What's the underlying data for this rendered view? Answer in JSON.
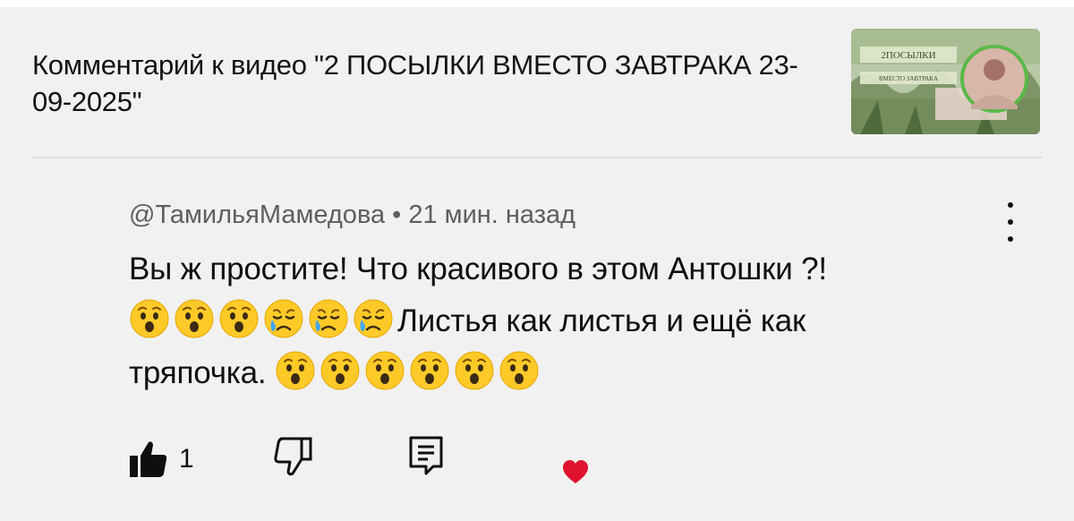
{
  "header": {
    "title": "Комментарий к видео \"2 ПОСЫЛКИ ВМЕСТО ЗАВТРАКА 23-09-2025\"",
    "thumbnail": {
      "caption_line1": "2ПОСЫЛКИ",
      "caption_line2": "ВМЕСТО ЗАВТРАКА"
    }
  },
  "comment": {
    "author": "@ТамильяМамедова",
    "separator": "•",
    "time": "21 мин. назад",
    "text_part1": "Вы ж простите! Что красивого в этом Антошки ?!",
    "text_part2": "Листья как листья и ещё как",
    "text_part3": "тряпочка.",
    "emoji_group1": [
      "astonished",
      "astonished",
      "astonished",
      "crying",
      "crying",
      "crying"
    ],
    "emoji_group2": [
      "astonished",
      "astonished",
      "astonished",
      "astonished",
      "astonished",
      "astonished"
    ]
  },
  "actions": {
    "like_count": "1",
    "heart_color": "#e0102f"
  },
  "icons": {
    "like": "thumb-up-icon",
    "dislike": "thumb-down-icon",
    "reply": "reply-icon",
    "menu": "more-vert-icon",
    "heart": "heart-icon"
  }
}
